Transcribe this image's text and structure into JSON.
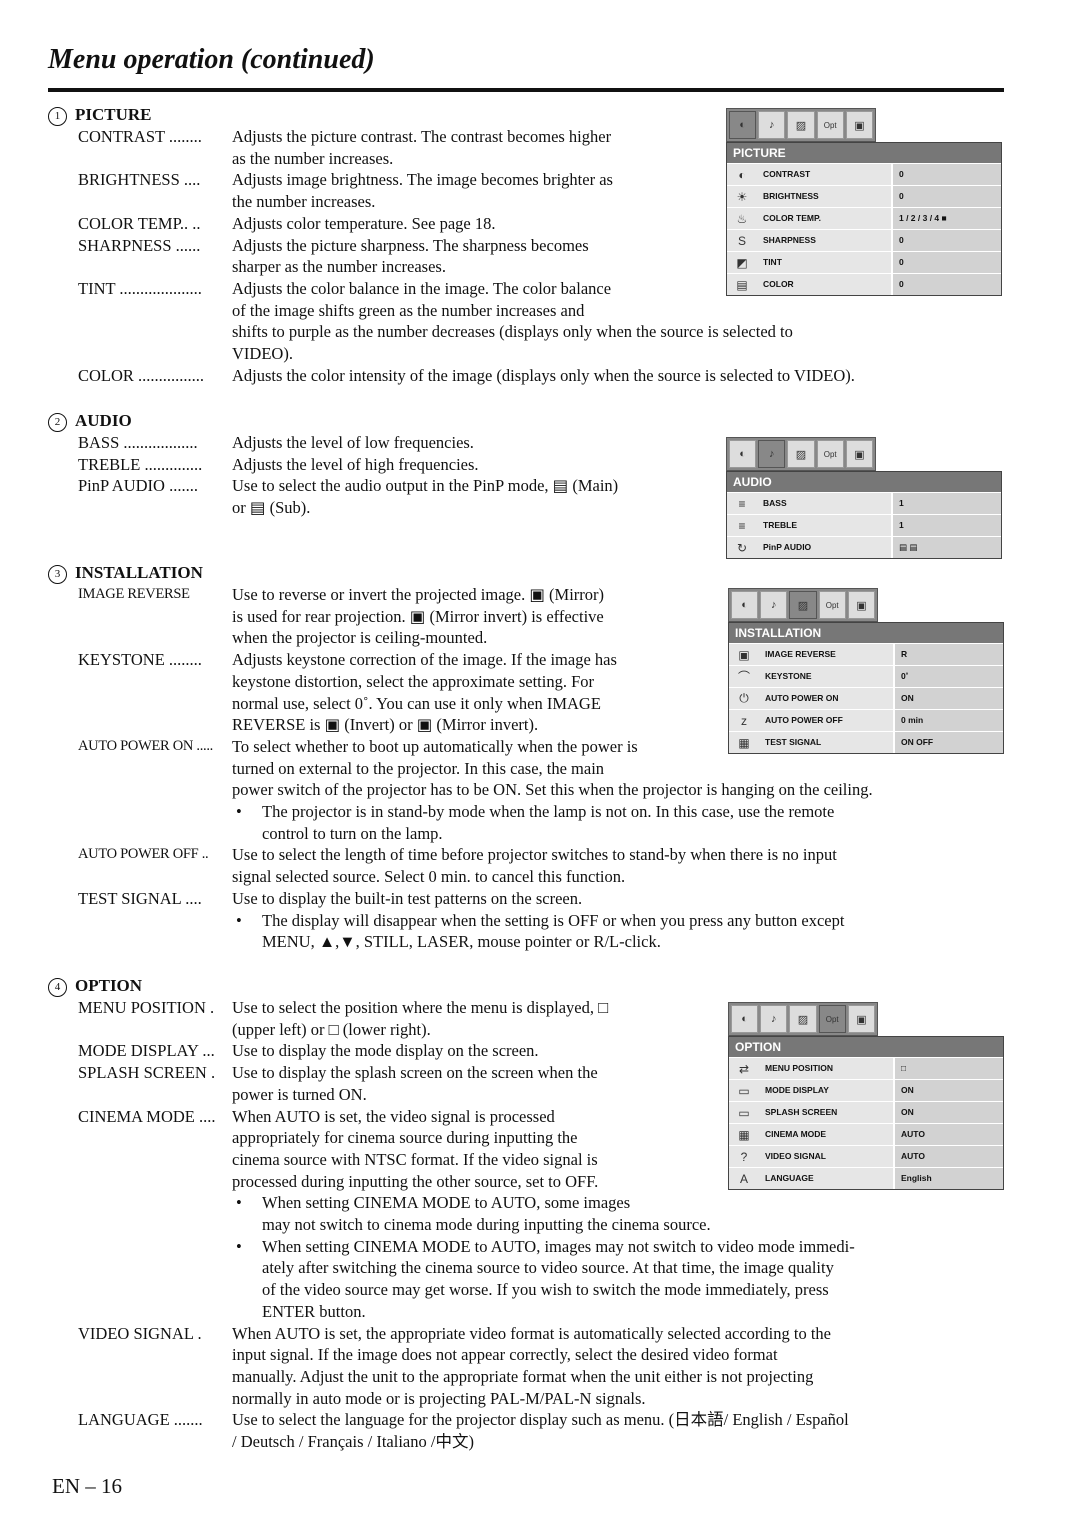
{
  "page": {
    "title": "Menu operation (continued)",
    "page_number": "EN – 16"
  },
  "sections": {
    "picture": {
      "num": "1",
      "heading": "PICTURE",
      "items": [
        {
          "term": "CONTRAST ........",
          "lines": [
            "Adjusts the picture contrast. The contrast becomes higher",
            "as the number increases."
          ]
        },
        {
          "term": "BRIGHTNESS ....",
          "lines": [
            "Adjusts image brightness. The image becomes brighter as",
            "the number increases."
          ]
        },
        {
          "term": "COLOR TEMP.. ..",
          "lines": [
            "Adjusts color temperature. See page 18."
          ]
        },
        {
          "term": "SHARPNESS ......",
          "lines": [
            "Adjusts the picture sharpness. The sharpness becomes",
            "sharper as the number increases."
          ]
        },
        {
          "term": "TINT ....................",
          "lines": [
            "Adjusts the color balance in the image.  The color balance",
            "of the image shifts green as the number increases and",
            "shifts to purple as the number decreases (displays only when the source is selected to",
            "VIDEO)."
          ]
        },
        {
          "term": "COLOR ................",
          "lines": [
            "Adjusts the color intensity of the image (displays only when the source is selected to VIDEO)."
          ]
        }
      ]
    },
    "audio": {
      "num": "2",
      "heading": "AUDIO",
      "items": [
        {
          "term": "BASS ..................",
          "lines": [
            "Adjusts the level of low frequencies."
          ]
        },
        {
          "term": "TREBLE ..............",
          "lines": [
            "Adjusts the level of high frequencies."
          ]
        },
        {
          "term": "PinP AUDIO .......",
          "lines": [
            "Use to select the audio output in the PinP mode, ▤ (Main)",
            "or ▤ (Sub)."
          ]
        }
      ]
    },
    "installation": {
      "num": "3",
      "heading": "INSTALLATION",
      "items": [
        {
          "term": "IMAGE REVERSE",
          "lines": [
            "Use to reverse or invert the projected image.  ▣ (Mirror)",
            "is used for rear projection.  ▣ (Mirror invert) is effective",
            "when the projector is ceiling-mounted."
          ]
        },
        {
          "term": "KEYSTONE ........",
          "lines": [
            "Adjusts keystone correction of the image. If the image has",
            "keystone distortion, select the approximate setting. For",
            "normal use, select 0˚. You can use it only when IMAGE",
            "REVERSE is ▣ (Invert) or ▣ (Mirror invert)."
          ]
        },
        {
          "term": "AUTO POWER ON .....",
          "lines": [
            "To select whether to boot up automatically when the power is",
            "turned on external to the projector. In this case, the main",
            "power switch of the projector has to be ON.  Set this when the projector is hanging on the ceiling."
          ]
        },
        {
          "term": "AUTO POWER OFF ..",
          "lines": [
            "Use to select the length of time before projector switches to stand-by when there is no input",
            "signal selected source. Select 0 min. to cancel this function."
          ]
        },
        {
          "term": "TEST SIGNAL ....",
          "lines": [
            "Use to display the built-in test patterns on the screen."
          ]
        }
      ],
      "bullets": {
        "auto_power_on": [
          "The projector is in stand-by mode when the lamp is not on. In this case, use the remote",
          "control to turn on the lamp."
        ],
        "test_signal": [
          "The display will disappear when the setting is OFF or when you press any button except",
          "MENU,  ▲,▼, STILL, LASER, mouse pointer or R/L-click."
        ]
      }
    },
    "option": {
      "num": "4",
      "heading": "OPTION",
      "items": [
        {
          "term": "MENU POSITION .",
          "lines": [
            "Use to select the position where the menu is displayed, □",
            "(upper left) or □ (lower right)."
          ]
        },
        {
          "term": "MODE DISPLAY ...",
          "lines": [
            "Use to display the mode display on the screen."
          ]
        },
        {
          "term": "SPLASH SCREEN .",
          "lines": [
            "Use to display the splash screen on the screen when the",
            "power is turned ON."
          ]
        },
        {
          "term": "CINEMA MODE ....",
          "lines": [
            "When AUTO is set, the video signal is processed",
            "appropriately for cinema source during inputting the",
            "cinema source with NTSC format. If the video signal is",
            "processed during inputting the other source, set to OFF."
          ]
        },
        {
          "term": "VIDEO SIGNAL .",
          "lines": [
            "When AUTO is set, the appropriate video format is automatically selected according to the",
            "input signal. If the image does not appear correctly, select the desired video format",
            "manually. Adjust the unit to the appropriate format when the unit either is not projecting",
            "normally in auto mode or is projecting PAL-M/PAL-N signals."
          ]
        },
        {
          "term": "LANGUAGE .......",
          "lines": [
            "Use to select the language for the projector display such as menu. (日本語/ English / Español",
            "/ Deutsch / Français / Italiano /中文)"
          ]
        }
      ],
      "bullets": {
        "cinema_mode": [
          [
            "When setting CINEMA MODE to AUTO, some images",
            "may not switch to cinema mode during inputting the cinema source."
          ],
          [
            "When setting CINEMA MODE to AUTO, images may not switch to video mode immedi-",
            "ately after switching the cinema source to video source. At that time, the image quality",
            "of the video source may get worse. If you wish to switch the mode immediately, press",
            "ENTER button."
          ]
        ]
      }
    }
  },
  "osd": {
    "tabs": [
      "picture-tab",
      "audio-tab",
      "installation-tab",
      "Opt",
      "setup-tab"
    ],
    "picture": {
      "title": "PICTURE",
      "rows": [
        {
          "label": "CONTRAST",
          "value": "0",
          "icon": "◐"
        },
        {
          "label": "BRIGHTNESS",
          "value": "0",
          "icon": "☀"
        },
        {
          "label": "COLOR TEMP.",
          "value": "1 / 2 / 3 / 4 ■",
          "icon": "♨"
        },
        {
          "label": "SHARPNESS",
          "value": "0",
          "icon": "S"
        },
        {
          "label": "TINT",
          "value": "0",
          "icon": "◩"
        },
        {
          "label": "COLOR",
          "value": "0",
          "icon": "▤"
        }
      ]
    },
    "audio": {
      "title": "AUDIO",
      "rows": [
        {
          "label": "BASS",
          "value": "1",
          "icon": "≡"
        },
        {
          "label": "TREBLE",
          "value": "1",
          "icon": "≡"
        },
        {
          "label": "PinP AUDIO",
          "value": "▤    ▤",
          "icon": "↻"
        }
      ]
    },
    "installation": {
      "title": "INSTALLATION",
      "rows": [
        {
          "label": "IMAGE REVERSE",
          "value": "R",
          "icon": "▣"
        },
        {
          "label": "KEYSTONE",
          "value": "0˚",
          "icon": "⌒"
        },
        {
          "label": "AUTO POWER ON",
          "value": "ON",
          "icon": "⏻"
        },
        {
          "label": "AUTO POWER OFF",
          "value": "0   min",
          "icon": "z"
        },
        {
          "label": "TEST SIGNAL",
          "value": "ON   OFF",
          "icon": "▦"
        }
      ]
    },
    "option": {
      "title": "OPTION",
      "rows": [
        {
          "label": "MENU POSITION",
          "value": "□",
          "icon": "⇄"
        },
        {
          "label": "MODE DISPLAY",
          "value": "ON",
          "icon": "▭"
        },
        {
          "label": "SPLASH SCREEN",
          "value": "ON",
          "icon": "▭"
        },
        {
          "label": "CINEMA MODE",
          "value": "AUTO",
          "icon": "▦"
        },
        {
          "label": "VIDEO SIGNAL",
          "value": "AUTO",
          "icon": "?"
        },
        {
          "label": "LANGUAGE",
          "value": "English",
          "icon": "A"
        }
      ]
    }
  }
}
